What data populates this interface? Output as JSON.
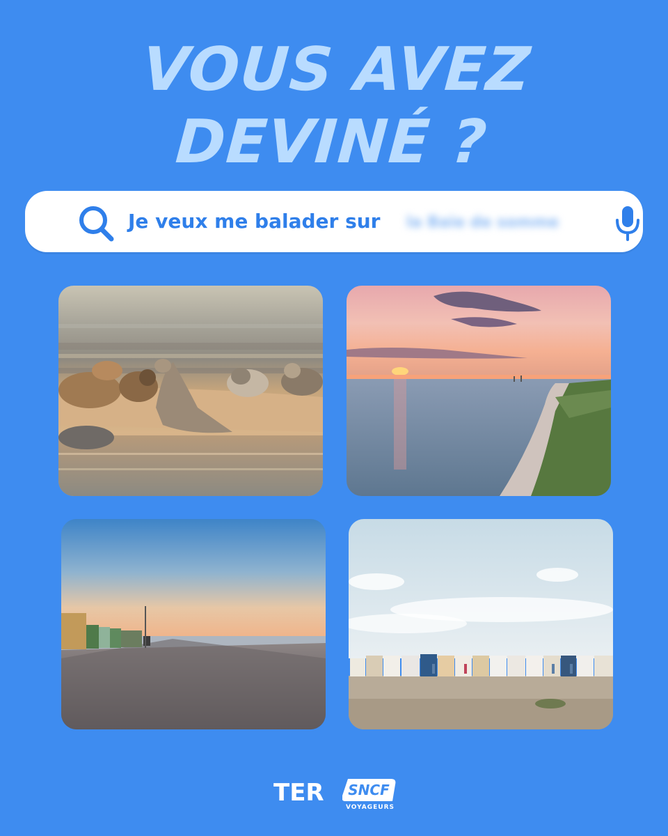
{
  "headline": {
    "line1": "VOUS AVEZ",
    "line2": "DEVINÉ ?"
  },
  "search": {
    "query_prefix": "Je veux me balader sur",
    "hidden_answer": "la Baie de somme",
    "search_icon": "search-icon",
    "mic_icon": "microphone-icon"
  },
  "photos": [
    {
      "subject": "seals resting on a sandbank at low tide"
    },
    {
      "subject": "aerial view of the coastline at sunset"
    },
    {
      "subject": "pebble beach with beach huts at dusk"
    },
    {
      "subject": "row of colorful beach huts on a pebble beach"
    }
  ],
  "footer": {
    "brand": "TER",
    "logo_text": "SNCF",
    "logo_sub": "VOYAGEURS"
  },
  "colors": {
    "background": "#3e8cf0",
    "headline": "#b9dcff",
    "accent": "#2f7fea"
  }
}
